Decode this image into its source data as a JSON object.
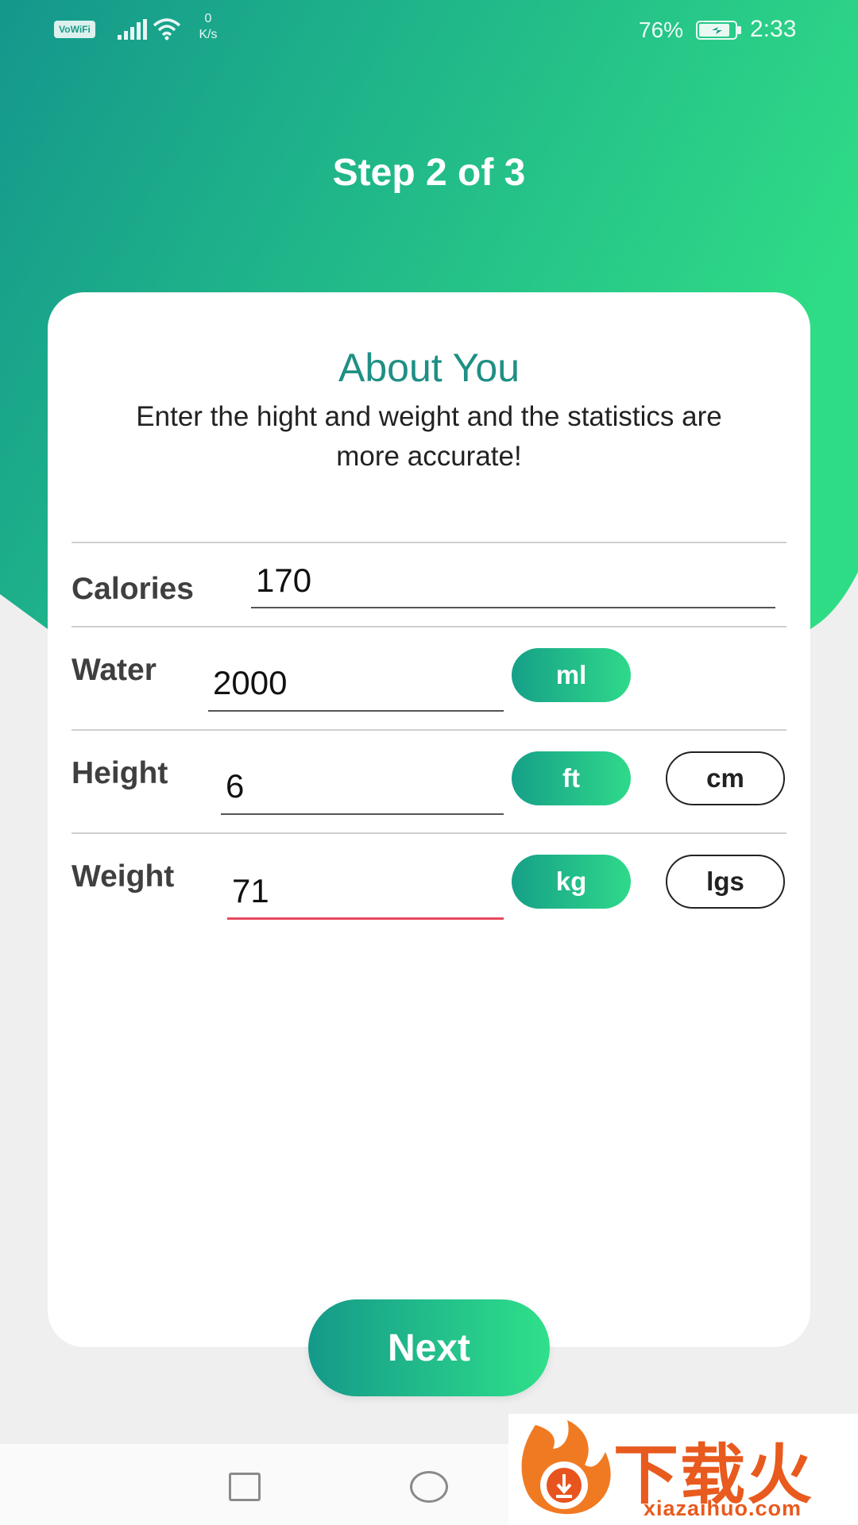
{
  "colors": {
    "header_gradient_start": "#14978c",
    "header_gradient_end": "#2fdc86",
    "accent_teal": "#1f8f84",
    "error_underline": "#e84a5f"
  },
  "status_bar": {
    "vowifi": "VoWiFi",
    "net_speed_value": "0",
    "net_speed_unit": "K/s",
    "battery_percent": "76%",
    "time": "2:33"
  },
  "header": {
    "step_title": "Step 2 of 3"
  },
  "card": {
    "title": "About You",
    "subtitle": "Enter the hight and weight and the statistics are more accurate!"
  },
  "fields": {
    "calories": {
      "label": "Calories",
      "value": "170"
    },
    "water": {
      "label": "Water",
      "value": "2000",
      "unit_selected": "ml"
    },
    "height": {
      "label": "Height",
      "value": "6",
      "unit_selected": "ft",
      "unit_other": "cm"
    },
    "weight": {
      "label": "Weight",
      "value": "71",
      "unit_selected": "kg",
      "unit_other": "lgs"
    }
  },
  "next_button": {
    "label": "Next"
  },
  "watermark": {
    "brand_cn": "下载火",
    "url": "xiazaihuo.com"
  }
}
